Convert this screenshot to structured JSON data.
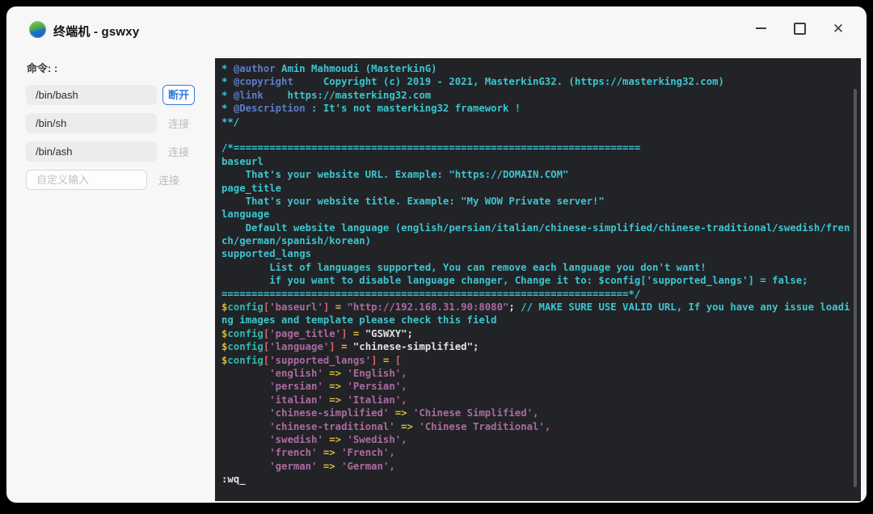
{
  "window": {
    "title": "终端机 - gswxy",
    "controls": [
      {
        "name": "minimize-icon",
        "action": "minimize"
      },
      {
        "name": "maximize-icon",
        "action": "maximize"
      },
      {
        "name": "close-icon",
        "action": "close"
      }
    ]
  },
  "sidebar": {
    "label": "命令: :",
    "rows": [
      {
        "type": "filled",
        "value": "/bin/bash",
        "button": "断开",
        "primary": true
      },
      {
        "type": "filled",
        "value": "/bin/sh",
        "button": "连接",
        "primary": false
      },
      {
        "type": "filled",
        "value": "/bin/ash",
        "button": "连接",
        "primary": false
      },
      {
        "type": "input",
        "placeholder": "自定义输入",
        "button": "连接",
        "primary": false
      }
    ]
  },
  "colors": {
    "accent_blue": "#2f7ae0",
    "terminal_bg": "#222327",
    "comment_cyan": "#3cc5ce",
    "tag_blue": "#5d7cc9",
    "operator_gold": "#d9b63d",
    "function_teal": "#2fb9af",
    "bracket_red": "#da5f68",
    "string_mauve": "#ab6ba0",
    "plain_white": "#e2e2e2"
  },
  "terminal": {
    "lines": [
      [
        [
          "cy",
          "* "
        ],
        [
          "bl",
          "@author"
        ],
        [
          "cy",
          " Amin Mahmoudi (MasterkinG)"
        ]
      ],
      [
        [
          "cy",
          "* "
        ],
        [
          "bl",
          "@copyright"
        ],
        [
          "cy",
          "     Copyright (c) 2019 - 2021, MasterkinG32. (https://masterking32.com)"
        ]
      ],
      [
        [
          "cy",
          "* "
        ],
        [
          "bl",
          "@link"
        ],
        [
          "cy",
          "    https://masterking32.com"
        ]
      ],
      [
        [
          "cy",
          "* "
        ],
        [
          "bl",
          "@Description"
        ],
        [
          "cy",
          " : It's not masterking32 framework !"
        ]
      ],
      [
        [
          "cy",
          "**/"
        ]
      ],
      [],
      [
        [
          "cy",
          "/*===================================================================="
        ]
      ],
      [
        [
          "cy",
          "baseurl"
        ]
      ],
      [
        [
          "cy",
          "    That's your website URL. Example: \"https://DOMAIN.COM\""
        ]
      ],
      [
        [
          "cy",
          "page_title"
        ]
      ],
      [
        [
          "cy",
          "    That's your website title. Example: \"My WOW Private server!\""
        ]
      ],
      [
        [
          "cy",
          "language"
        ]
      ],
      [
        [
          "cy",
          "    Default website language (english/persian/italian/chinese-simplified/chinese-traditional/swedish/fren"
        ]
      ],
      [
        [
          "cy",
          "ch/german/spanish/korean)"
        ]
      ],
      [
        [
          "cy",
          "supported_langs"
        ]
      ],
      [
        [
          "cy",
          "        List of languages supported, You can remove each language you don't want!"
        ]
      ],
      [
        [
          "cy",
          "        if you want to disable language changer, Change it to: $config['supported_langs'] = false;"
        ]
      ],
      [
        [
          "cy",
          "====================================================================*/"
        ]
      ],
      [
        [
          "ye",
          "$"
        ],
        [
          "te",
          "config"
        ],
        [
          "rd",
          "["
        ],
        [
          "ma",
          "'baseurl'"
        ],
        [
          "rd",
          "]"
        ],
        [
          "wh",
          " "
        ],
        [
          "ye",
          "="
        ],
        [
          "wh",
          " "
        ],
        [
          "ma",
          "\"http://192.168.31.90:8080\""
        ],
        [
          "wh",
          "; "
        ],
        [
          "cy",
          "// MAKE SURE USE VALID URL, If you have any issue loadi"
        ]
      ],
      [
        [
          "cy",
          "ng images and template please check this field"
        ]
      ],
      [
        [
          "ye",
          "$"
        ],
        [
          "te",
          "config"
        ],
        [
          "rd",
          "["
        ],
        [
          "ma",
          "'page_title'"
        ],
        [
          "rd",
          "]"
        ],
        [
          "wh",
          " "
        ],
        [
          "ye",
          "="
        ],
        [
          "wh",
          " \"GSWXY\";"
        ]
      ],
      [
        [
          "ye",
          "$"
        ],
        [
          "te",
          "config"
        ],
        [
          "rd",
          "["
        ],
        [
          "ma",
          "'language'"
        ],
        [
          "rd",
          "]"
        ],
        [
          "wh",
          " "
        ],
        [
          "ye",
          "="
        ],
        [
          "wh",
          " \"chinese-simplified\";"
        ]
      ],
      [
        [
          "ye",
          "$"
        ],
        [
          "te",
          "config"
        ],
        [
          "rd",
          "["
        ],
        [
          "ma",
          "'supported_langs'"
        ],
        [
          "rd",
          "]"
        ],
        [
          "wh",
          " "
        ],
        [
          "ye",
          "="
        ],
        [
          "wh",
          " "
        ],
        [
          "rd",
          "["
        ]
      ],
      [
        [
          "wh",
          "        "
        ],
        [
          "ma",
          "'english'"
        ],
        [
          "wh",
          " "
        ],
        [
          "ye",
          "=>"
        ],
        [
          "wh",
          " "
        ],
        [
          "ma",
          "'English'"
        ],
        [
          "rd",
          ","
        ]
      ],
      [
        [
          "wh",
          "        "
        ],
        [
          "ma",
          "'persian'"
        ],
        [
          "wh",
          " "
        ],
        [
          "ye",
          "=>"
        ],
        [
          "wh",
          " "
        ],
        [
          "ma",
          "'Persian'"
        ],
        [
          "rd",
          ","
        ]
      ],
      [
        [
          "wh",
          "        "
        ],
        [
          "ma",
          "'italian'"
        ],
        [
          "wh",
          " "
        ],
        [
          "ye",
          "=>"
        ],
        [
          "wh",
          " "
        ],
        [
          "ma",
          "'Italian'"
        ],
        [
          "rd",
          ","
        ]
      ],
      [
        [
          "wh",
          "        "
        ],
        [
          "ma",
          "'chinese-simplified'"
        ],
        [
          "wh",
          " "
        ],
        [
          "ye",
          "=>"
        ],
        [
          "wh",
          " "
        ],
        [
          "ma",
          "'Chinese Simplified'"
        ],
        [
          "rd",
          ","
        ]
      ],
      [
        [
          "wh",
          "        "
        ],
        [
          "ma",
          "'chinese-traditional'"
        ],
        [
          "wh",
          " "
        ],
        [
          "ye",
          "=>"
        ],
        [
          "wh",
          " "
        ],
        [
          "ma",
          "'Chinese Traditional'"
        ],
        [
          "rd",
          ","
        ]
      ],
      [
        [
          "wh",
          "        "
        ],
        [
          "ma",
          "'swedish'"
        ],
        [
          "wh",
          " "
        ],
        [
          "ye",
          "=>"
        ],
        [
          "wh",
          " "
        ],
        [
          "ma",
          "'Swedish'"
        ],
        [
          "rd",
          ","
        ]
      ],
      [
        [
          "wh",
          "        "
        ],
        [
          "ma",
          "'french'"
        ],
        [
          "wh",
          " "
        ],
        [
          "ye",
          "=>"
        ],
        [
          "wh",
          " "
        ],
        [
          "ma",
          "'French'"
        ],
        [
          "rd",
          ","
        ]
      ],
      [
        [
          "wh",
          "        "
        ],
        [
          "ma",
          "'german'"
        ],
        [
          "wh",
          " "
        ],
        [
          "ye",
          "=>"
        ],
        [
          "wh",
          " "
        ],
        [
          "ma",
          "'German'"
        ],
        [
          "rd",
          ","
        ]
      ],
      [
        [
          "wh",
          ":wq"
        ],
        [
          "cur",
          "_"
        ]
      ]
    ]
  }
}
